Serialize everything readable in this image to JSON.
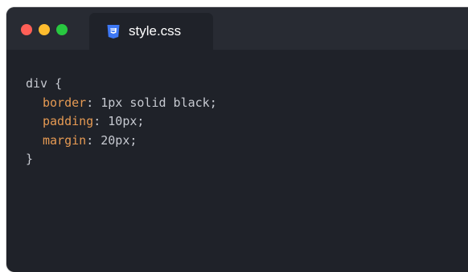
{
  "window": {
    "traffic_lights": [
      {
        "name": "close",
        "color": "#ff5f57"
      },
      {
        "name": "minimize",
        "color": "#febc2e"
      },
      {
        "name": "zoom",
        "color": "#28c840"
      }
    ]
  },
  "tab": {
    "label": "style.css",
    "icon": "css3-icon",
    "icon_color": "#3d78f5"
  },
  "code": {
    "selector": "div",
    "open_brace": "{",
    "close_brace": "}",
    "declarations": [
      {
        "property": "border",
        "value": "1px solid black"
      },
      {
        "property": "padding",
        "value": "10px"
      },
      {
        "property": "margin",
        "value": "20px"
      }
    ],
    "colors": {
      "property": "#e69a53",
      "text": "#c7cad1",
      "background": "#1f2229",
      "titlebar": "#282b33"
    }
  }
}
